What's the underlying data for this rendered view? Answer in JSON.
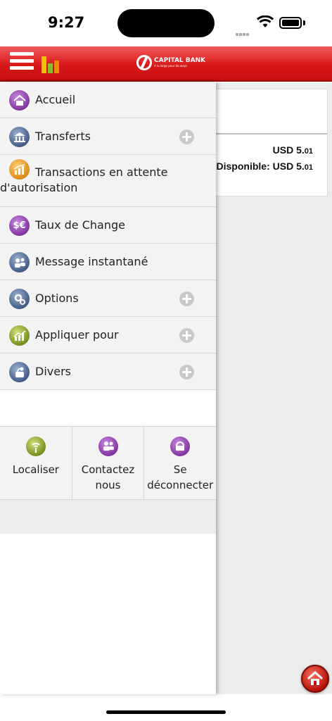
{
  "status_bar": {
    "time": "9:27"
  },
  "header": {
    "logo_text": "CAPITAL BANK",
    "logo_tagline": "A lo largo pour da ways"
  },
  "account_card": {
    "balance": "USD 5.",
    "balance_cents": "01",
    "available_label": "Disponible: USD 5.",
    "available_cents": "01"
  },
  "drawer": {
    "items": [
      {
        "label": "Accueil",
        "icon": "home-icon",
        "expandable": false
      },
      {
        "label": "Transferts",
        "icon": "bank-icon",
        "expandable": true
      },
      {
        "label": "Transactions en attente d'autorisation",
        "icon": "chart-icon",
        "expandable": false
      },
      {
        "label": "Taux de Change",
        "icon": "currency-exchange-icon",
        "expandable": false
      },
      {
        "label": "Message instantané",
        "icon": "chat-users-icon",
        "expandable": false
      },
      {
        "label": "Options",
        "icon": "gear-icon",
        "expandable": true
      },
      {
        "label": "Appliquer pour",
        "icon": "apply-chart-icon",
        "expandable": true
      },
      {
        "label": "Divers",
        "icon": "misc-icon",
        "expandable": true
      }
    ],
    "quick_actions": [
      {
        "label": "Localiser",
        "icon": "location-icon"
      },
      {
        "label": "Contactez nous",
        "icon": "contact-icon"
      },
      {
        "label": "Se déconnecter",
        "icon": "logout-icon"
      }
    ]
  },
  "colors": {
    "header_red": "#d81818",
    "accent_purple": "#7b2f9c"
  }
}
